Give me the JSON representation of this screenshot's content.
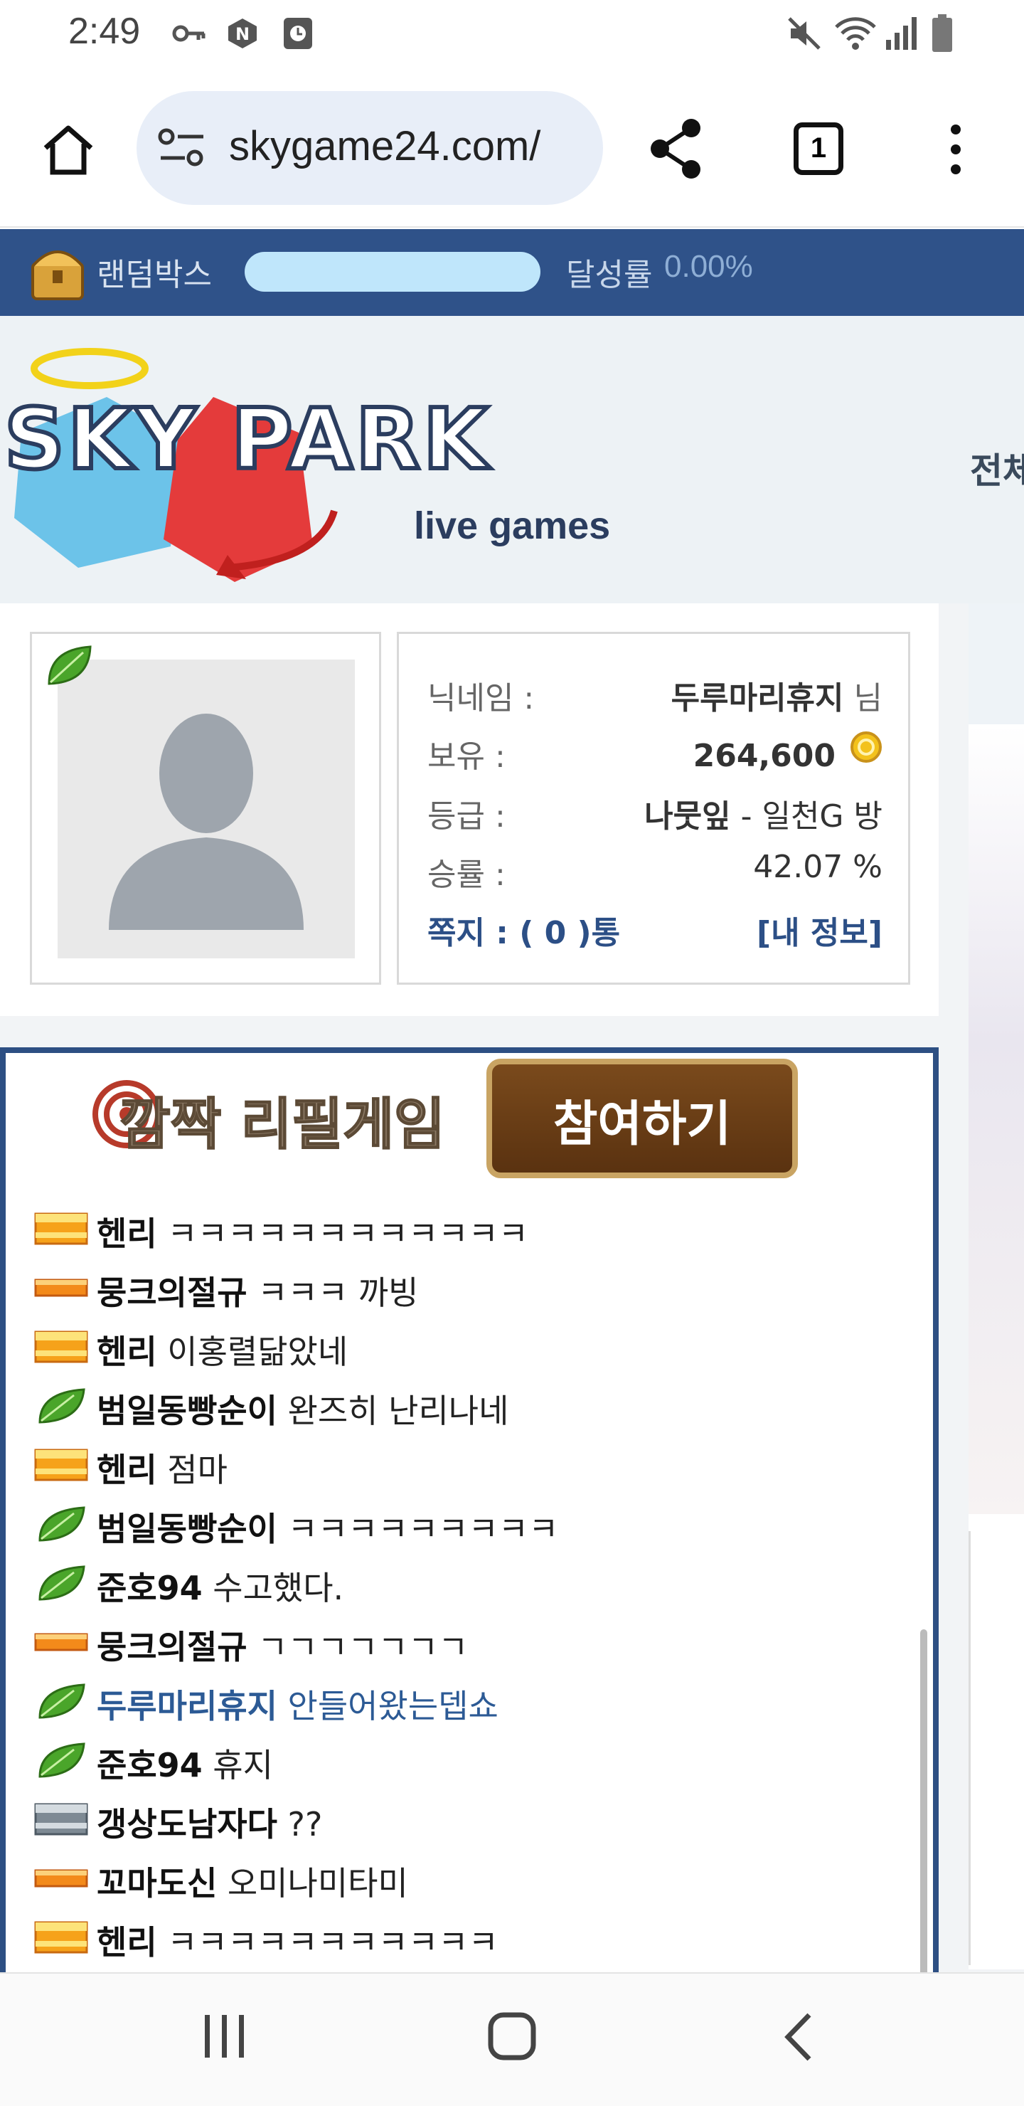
{
  "status_bar": {
    "time": "2:49"
  },
  "browser": {
    "url": "skygame24.com/",
    "tab_count": "1"
  },
  "random_box": {
    "label": "랜덤박스",
    "progress_fraction": 0.0,
    "rate_label": "달성률",
    "rate_value": "0.00%"
  },
  "header": {
    "logo_text": "SKY PARK",
    "logo_sub": "live games",
    "right_text": "전체"
  },
  "profile": {
    "nickname_label": "닉네임 :",
    "nickname_value": "두루마리휴지",
    "nickname_suffix": "님",
    "money_label": "보유 :",
    "money_value": "264,600",
    "grade_label": "등급 :",
    "grade_value": "나뭇잎",
    "grade_room": "- 일천G 방",
    "winrate_label": "승률 :",
    "winrate_value": "42.07 %",
    "message_label": "쪽지 : ( 0 )통",
    "my_info_link": "[내 정보]"
  },
  "chat": {
    "title": "깜짝 리필게임",
    "join_label": "참여하기",
    "items": [
      {
        "rank": "gold",
        "name": "헨리",
        "msg": "ㅋㅋㅋㅋㅋㅋㅋㅋㅋㅋㅋㅋ"
      },
      {
        "rank": "orange",
        "name": "뭉크의절규",
        "msg": "ㅋㅋㅋ 까빙"
      },
      {
        "rank": "gold",
        "name": "헨리",
        "msg": "이홍렬닮았네"
      },
      {
        "rank": "leaf",
        "name": "범일동빵순이",
        "msg": "완즈히 난리나네"
      },
      {
        "rank": "gold",
        "name": "헨리",
        "msg": "점마"
      },
      {
        "rank": "leaf",
        "name": "범일동빵순이",
        "msg": "ㅋㅋㅋㅋㅋㅋㅋㅋㅋ"
      },
      {
        "rank": "leaf",
        "name": "준호94",
        "msg": "수고했다."
      },
      {
        "rank": "orange",
        "name": "뭉크의절규",
        "msg": "ㄱㄱㄱㄱㄱㄱㄱ"
      },
      {
        "rank": "leaf",
        "name": "두루마리휴지",
        "msg": "안들어왔는뎁쇼",
        "self": true
      },
      {
        "rank": "leaf",
        "name": "준호94",
        "msg": "휴지"
      },
      {
        "rank": "silver",
        "name": "갱상도남자다",
        "msg": "??"
      },
      {
        "rank": "orange",
        "name": "꼬마도신",
        "msg": "오미나미타미"
      },
      {
        "rank": "gold",
        "name": "헨리",
        "msg": "ㅋㅋㅋㅋㅋㅋㅋㅋㅋㅋㅋ"
      }
    ]
  },
  "colors": {
    "brand_navy": "#2f5289",
    "link_blue": "#2c4f86",
    "self_blue": "#2c5a95"
  }
}
